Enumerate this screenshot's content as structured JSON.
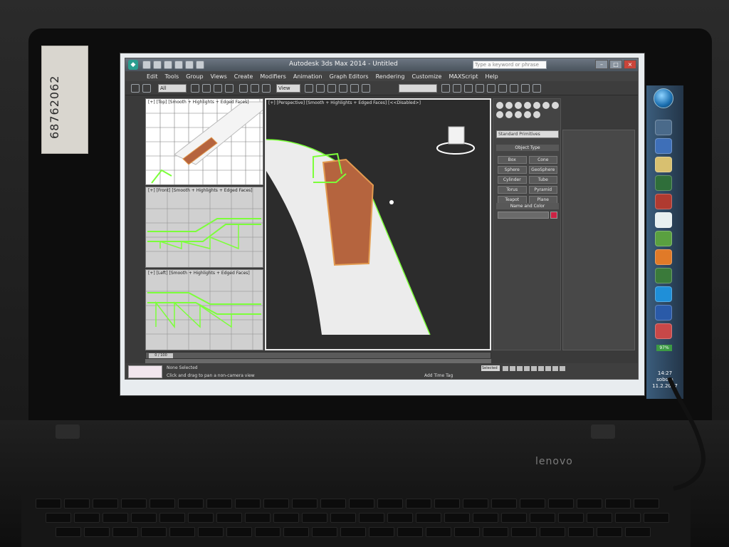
{
  "sticker": {
    "text": "68762062"
  },
  "window": {
    "title": "Autodesk 3ds Max 2014 - Untitled",
    "search_placeholder": "Type a keyword or phrase"
  },
  "menu": [
    "Edit",
    "Tools",
    "Group",
    "Views",
    "Create",
    "Modifiers",
    "Animation",
    "Graph Editors",
    "Rendering",
    "Customize",
    "MAXScript",
    "Help"
  ],
  "toolbar": {
    "selection_filter": "All",
    "view_dropdown": "View"
  },
  "viewports": {
    "top": "[+] [Top] [Smooth + Highlights + Edged Faces]",
    "front": "[+] [Front] [Smooth + Highlights + Edged Faces]",
    "left": "[+] [Left] [Smooth + Highlights + Edged Faces]",
    "perspective": "[+] [Perspective] [Smooth + Highlights + Edged Faces] [<<Disabled>]"
  },
  "command_panel": {
    "category": "Standard Primitives",
    "object_type_title": "Object Type",
    "name_color_title": "Name and Color",
    "objects": [
      "Box",
      "Cone",
      "Sphere",
      "GeoSphere",
      "Cylinder",
      "Tube",
      "Torus",
      "Pyramid",
      "Teapot",
      "Plane"
    ]
  },
  "timeline": {
    "slider": "0 / 100"
  },
  "status": {
    "selected": "None Selected",
    "prompt": "Click and drag to pan a non-camera view",
    "add_time_tag": "Add Time Tag",
    "auto_key": "Selected"
  },
  "taskbar": {
    "battery": "97%",
    "clock_time": "14:27",
    "clock_day": "sobota",
    "clock_date": "11.2.2017"
  },
  "brand": "lenovo",
  "colors": {
    "wire_green": "#7cff3a",
    "brick": "#b5643e",
    "road": "#ececec",
    "viewport_bg": "#2c2c2c"
  }
}
